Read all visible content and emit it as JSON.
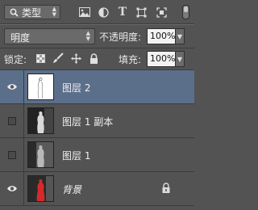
{
  "filter": {
    "type_label": "类型"
  },
  "blend": {
    "mode": "明度",
    "opacity_label": "不透明度:",
    "opacity_value": "100%"
  },
  "lock": {
    "label": "锁定:",
    "fill_label": "填充:",
    "fill_value": "100%"
  },
  "layers": [
    {
      "name": "图层 2",
      "visible": true,
      "selected": true,
      "locked": false,
      "italic": false
    },
    {
      "name": "图层 1 副本",
      "visible": false,
      "selected": false,
      "locked": false,
      "italic": false
    },
    {
      "name": "图层 1",
      "visible": false,
      "selected": false,
      "locked": false,
      "italic": false
    },
    {
      "name": "背景",
      "visible": true,
      "selected": false,
      "locked": true,
      "italic": true
    }
  ],
  "colors": {
    "panel": "#535353",
    "selected_row": "#5b6f8a",
    "field": "#f3f3f3"
  }
}
